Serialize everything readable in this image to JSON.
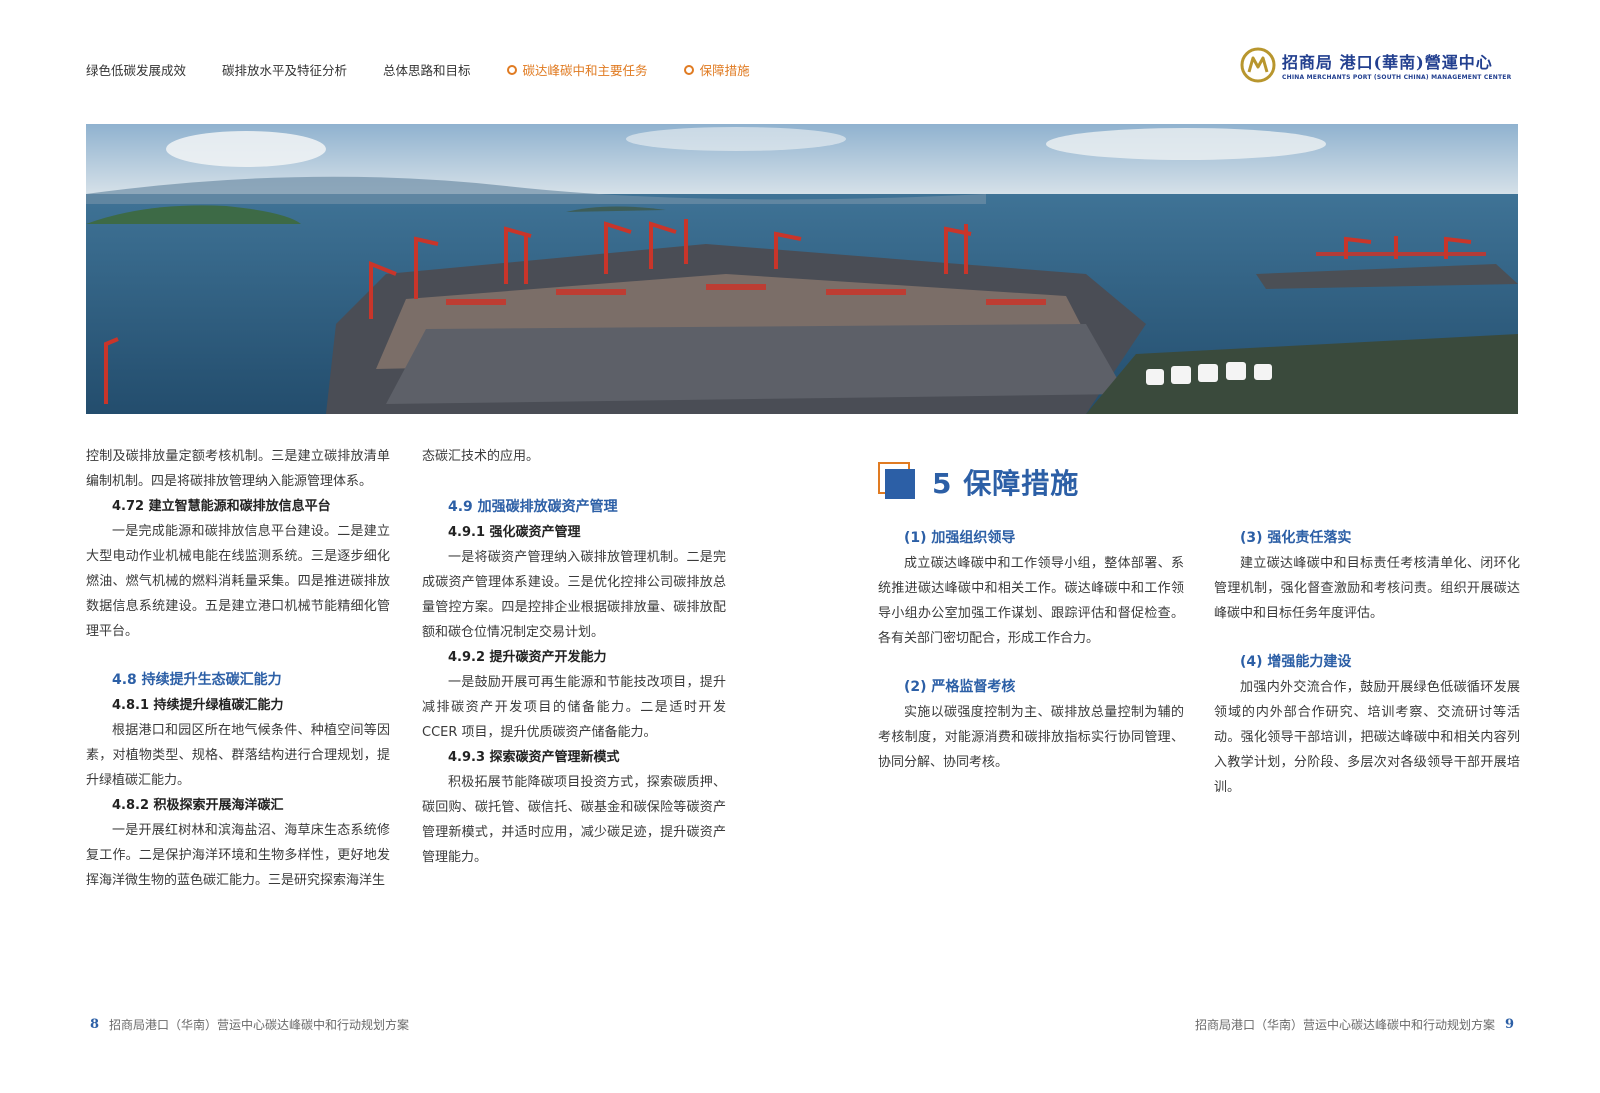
{
  "nav": {
    "items": [
      {
        "label": "绿色低碳发展成效"
      },
      {
        "label": "碳排放水平及特征分析"
      },
      {
        "label": "总体思路和目标"
      },
      {
        "label": "碳达峰碳中和主要任务"
      },
      {
        "label": "保障措施"
      }
    ]
  },
  "logo": {
    "cn": "招商局 港口(華南)營運中心",
    "en": "CHINA MERCHANTS PORT (SOUTH CHINA) MANAGEMENT CENTER"
  },
  "col1": {
    "p1": "控制及碳排放量定额考核机制。三是建立碳排放清单编制机制。四是将碳排放管理纳入能源管理体系。",
    "h472": "4.72 建立智慧能源和碳排放信息平台",
    "p472": "一是完成能源和碳排放信息平台建设。二是建立大型电动作业机械电能在线监测系统。三是逐步细化燃油、燃气机械的燃料消耗量采集。四是推进碳排放数据信息系统建设。五是建立港口机械节能精细化管理平台。",
    "h48": "4.8 持续提升生态碳汇能力",
    "h481": "4.8.1 持续提升绿植碳汇能力",
    "p481": "根据港口和园区所在地气候条件、种植空间等因素，对植物类型、规格、群落结构进行合理规划，提升绿植碳汇能力。",
    "h482": "4.8.2 积极探索开展海洋碳汇",
    "p482": "一是开展红树林和滨海盐沼、海草床生态系统修复工作。二是保护海洋环境和生物多样性，更好地发挥海洋微生物的蓝色碳汇能力。三是研究探索海洋生"
  },
  "col2": {
    "p1": "态碳汇技术的应用。",
    "h49": "4.9 加强碳排放碳资产管理",
    "h491": "4.9.1 强化碳资产管理",
    "p491": "一是将碳资产管理纳入碳排放管理机制。二是完成碳资产管理体系建设。三是优化控排公司碳排放总量管控方案。四是控排企业根据碳排放量、碳排放配额和碳仓位情况制定交易计划。",
    "h492": "4.9.2 提升碳资产开发能力",
    "p492": "一是鼓励开展可再生能源和节能技改项目，提升减排碳资产开发项目的储备能力。二是适时开发CCER 项目，提升优质碳资产储备能力。",
    "h493": "4.9.3 探索碳资产管理新模式",
    "p493": "积极拓展节能降碳项目投资方式，探索碳质押、碳回购、碳托管、碳信托、碳基金和碳保险等碳资产管理新模式，并适时应用，减少碳足迹，提升碳资产管理能力。"
  },
  "section5": {
    "title": "5 保障措施",
    "s1_title": "(1) 加强组织领导",
    "s1_text": "成立碳达峰碳中和工作领导小组，整体部署、系统推进碳达峰碳中和相关工作。碳达峰碳中和工作领导小组办公室加强工作谋划、跟踪评估和督促检查。各有关部门密切配合，形成工作合力。",
    "s2_title": "(2) 严格监督考核",
    "s2_text": "实施以碳强度控制为主、碳排放总量控制为辅的考核制度，对能源消费和碳排放指标实行协同管理、协同分解、协同考核。",
    "s3_title": "(3) 强化责任落实",
    "s3_text": "建立碳达峰碳中和目标责任考核清单化、闭环化管理机制，强化督查激励和考核问责。组织开展碳达峰碳中和目标任务年度评估。",
    "s4_title": "(4) 增强能力建设",
    "s4_text": "加强内外交流合作，鼓励开展绿色低碳循环发展领域的内外部合作研究、培训考察、交流研讨等活动。强化领导干部培训，把碳达峰碳中和相关内容列入教学计划，分阶段、多层次对各级领导干部开展培训。"
  },
  "footer": {
    "left_num": "8",
    "left_text": "招商局港口（华南）营运中心碳达峰碳中和行动规划方案",
    "right_text": "招商局港口（华南）营运中心碳达峰碳中和行动规划方案",
    "right_num": "9"
  },
  "colors": {
    "accent_blue": "#2c5fa6",
    "accent_orange": "#e07b22",
    "crane_red": "#c9352a",
    "sea": "#2f5f82"
  },
  "icons": [
    "target-dot-icon",
    "cmg-logo-icon",
    "section-square-icon"
  ]
}
